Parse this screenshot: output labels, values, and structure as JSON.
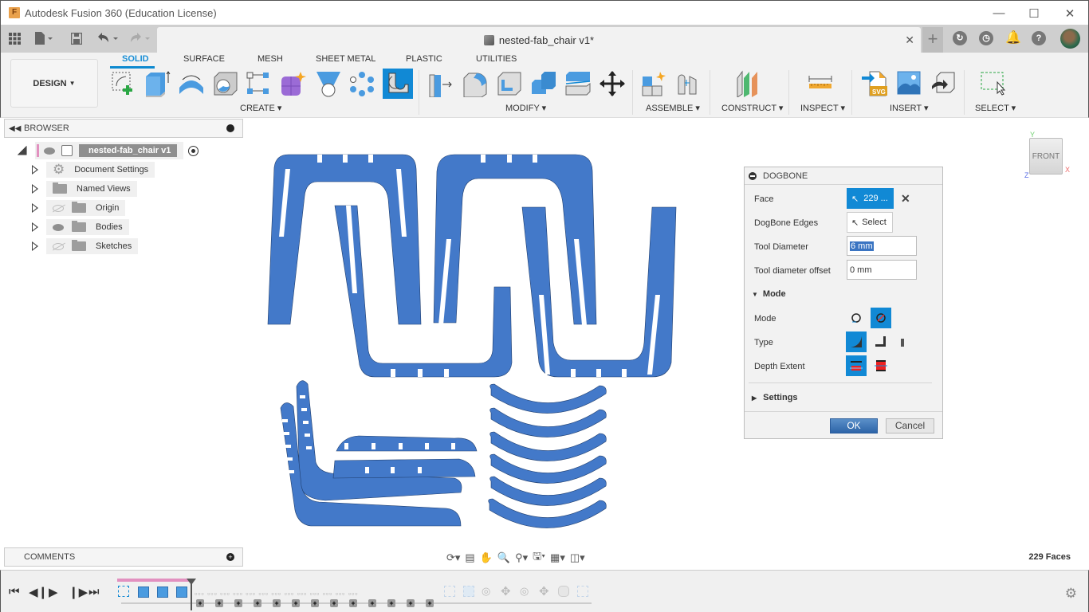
{
  "window": {
    "title": "Autodesk Fusion 360 (Education License)",
    "app_icon": "F",
    "controls": [
      "minimize-icon",
      "maximize-icon",
      "close-icon"
    ]
  },
  "quick_access": {
    "icons": [
      "data-panel-grid-icon",
      "file-menu-icon",
      "save-icon",
      "undo-icon",
      "redo-icon"
    ],
    "document_tab": "nested-fab_chair v1*",
    "right_icons": [
      "new-tab-plus-icon",
      "job-status-icon",
      "history-clock-icon",
      "notifications-bell-icon",
      "help-icon",
      "user-avatar"
    ]
  },
  "ribbon": {
    "workspace": "DESIGN",
    "tabs": [
      {
        "label": "SOLID",
        "active": true
      },
      {
        "label": "SURFACE",
        "active": false
      },
      {
        "label": "MESH",
        "active": false
      },
      {
        "label": "SHEET METAL",
        "active": false
      },
      {
        "label": "PLASTIC",
        "active": false
      },
      {
        "label": "UTILITIES",
        "active": false
      }
    ],
    "groups": [
      {
        "label": "CREATE",
        "tools": [
          "create-sketch",
          "extrude",
          "revolve",
          "hole",
          "rectangular-pattern",
          "create-form",
          "loft",
          "circular-pattern",
          "dogbone-addin"
        ]
      },
      {
        "label": "MODIFY",
        "tools": [
          "press-pull",
          "fillet",
          "shell",
          "combine",
          "split-body",
          "move-copy"
        ]
      },
      {
        "label": "ASSEMBLE",
        "tools": [
          "new-component",
          "joint"
        ]
      },
      {
        "label": "CONSTRUCT",
        "tools": [
          "offset-plane"
        ]
      },
      {
        "label": "INSPECT",
        "tools": [
          "measure"
        ]
      },
      {
        "label": "INSERT",
        "tools": [
          "insert-svg",
          "insert-canvas",
          "insert-mesh"
        ]
      },
      {
        "label": "SELECT",
        "tools": [
          "window-select"
        ]
      }
    ]
  },
  "browser": {
    "title": "BROWSER",
    "root": "nested-fab_chair v1",
    "items": [
      {
        "label": "Document Settings",
        "icon": "gear-icon",
        "visibility": null
      },
      {
        "label": "Named Views",
        "icon": "folder-icon",
        "visibility": null
      },
      {
        "label": "Origin",
        "icon": "folder-icon",
        "visibility": "hidden"
      },
      {
        "label": "Bodies",
        "icon": "folder-icon",
        "visibility": "visible"
      },
      {
        "label": "Sketches",
        "icon": "folder-icon",
        "visibility": "hidden"
      }
    ]
  },
  "comments": {
    "title": "COMMENTS"
  },
  "viewcube": {
    "face": "FRONT",
    "axes": [
      "Y",
      "Z",
      "X"
    ]
  },
  "dialog": {
    "title": "DOGBONE",
    "face_label": "Face",
    "face_value": "229 ...",
    "edges_label": "DogBone Edges",
    "edges_value": "Select",
    "tool_diameter_label": "Tool Diameter",
    "tool_diameter_value": "6 mm",
    "offset_label": "Tool diameter offset",
    "offset_value": "0 mm",
    "mode_section": "Mode",
    "mode_label": "Mode",
    "type_label": "Type",
    "depth_label": "Depth Extent",
    "settings_section": "Settings",
    "ok": "OK",
    "cancel": "Cancel"
  },
  "status": {
    "selection": "229 Faces"
  },
  "accent": {
    "blue": "#1189d5",
    "part_blue": "#4379c9",
    "timeline_pink": "#e291c0"
  }
}
